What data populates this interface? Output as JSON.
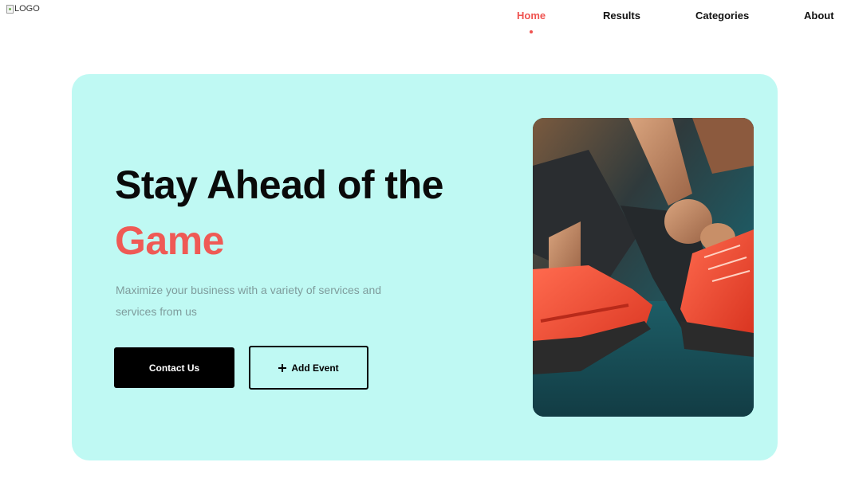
{
  "header": {
    "logo_alt": "LOGO",
    "nav": {
      "home": "Home",
      "results": "Results",
      "categories": "Categories",
      "about": "About"
    },
    "active_item": "Home"
  },
  "hero": {
    "headline_line1": "Stay Ahead of the",
    "headline_line2": "Game",
    "subtitle": "Maximize your business with a variety of services and services from us",
    "contact_label": "Contact Us",
    "add_event_label": "Add Event",
    "image_alt": "Runner tying red running shoes"
  },
  "colors": {
    "accent": "#ef5350",
    "hero_background": "#bff9f3",
    "primary_button": "#000000"
  },
  "icons": {
    "add_event": "plus-icon"
  }
}
